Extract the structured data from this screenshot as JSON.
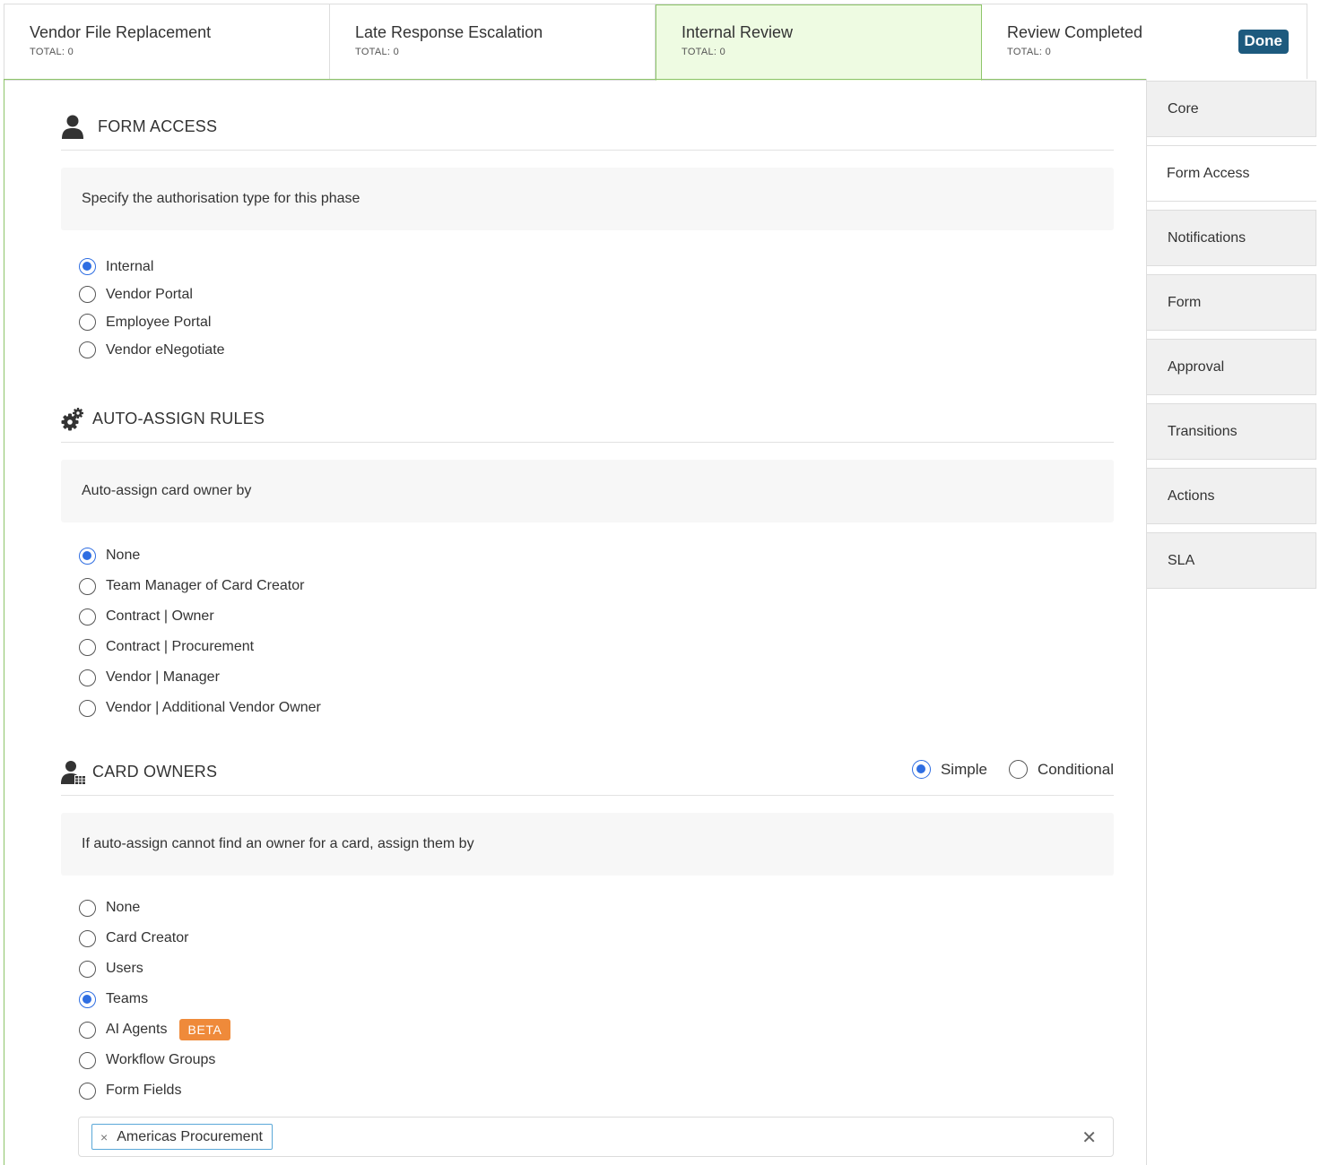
{
  "phases": [
    {
      "name": "Vendor File Replacement",
      "total": "TOTAL: 0"
    },
    {
      "name": "Late Response Escalation",
      "total": "TOTAL: 0"
    },
    {
      "name": "Internal Review",
      "total": "TOTAL: 0"
    },
    {
      "name": "Review Completed",
      "total": "TOTAL: 0",
      "badge": "Done"
    }
  ],
  "active_phase": "Internal Review",
  "form_access": {
    "title": "FORM ACCESS",
    "icon": "user-icon",
    "instruction": "Specify the authorisation type for this phase",
    "options": [
      "Internal",
      "Vendor Portal",
      "Employee Portal",
      "Vendor eNegotiate"
    ],
    "selected": "Internal"
  },
  "auto_assign": {
    "title": "AUTO-ASSIGN RULES",
    "icon": "gears-icon",
    "instruction": "Auto-assign card owner by",
    "options": [
      "None",
      "Team Manager of Card Creator",
      "Contract | Owner",
      "Contract | Procurement",
      "Vendor | Manager",
      "Vendor | Additional Vendor Owner"
    ],
    "selected": "None"
  },
  "card_owners": {
    "title": "CARD OWNERS",
    "icon": "user-table-icon",
    "mode_options": [
      "Simple",
      "Conditional"
    ],
    "mode_selected": "Simple",
    "instruction": "If auto-assign cannot find an owner for a card, assign them by",
    "options": [
      "None",
      "Card Creator",
      "Users",
      "Teams",
      "AI Agents",
      "Workflow Groups",
      "Form Fields"
    ],
    "selected": "Teams",
    "beta_label": "BETA",
    "selected_tags": [
      "Americas Procurement"
    ],
    "chip_remove": "×",
    "clear_all": "✕"
  },
  "side_nav": {
    "items": [
      "Core",
      "Form Access",
      "Notifications",
      "Form",
      "Approval",
      "Transitions",
      "Actions",
      "SLA"
    ],
    "active": "Form Access"
  },
  "colors": {
    "accent_blue": "#2f6ee2",
    "active_tab_bg": "#eefbe2",
    "active_tab_border": "#8ec56a",
    "done_badge": "#1d5a7e",
    "beta_badge": "#ef8a3a",
    "tag_border": "#5aa8d8"
  }
}
